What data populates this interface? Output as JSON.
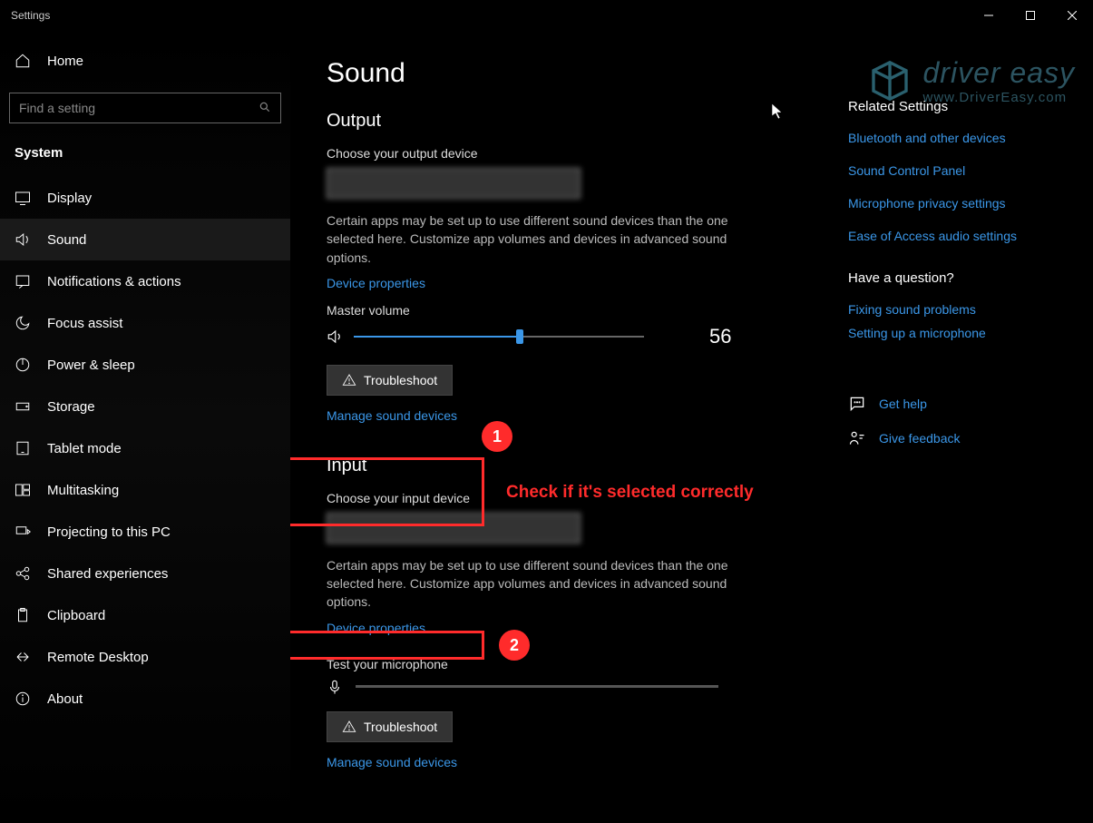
{
  "window": {
    "title": "Settings"
  },
  "sidebar": {
    "home": "Home",
    "search_placeholder": "Find a setting",
    "section": "System",
    "items": [
      {
        "label": "Display"
      },
      {
        "label": "Sound"
      },
      {
        "label": "Notifications & actions"
      },
      {
        "label": "Focus assist"
      },
      {
        "label": "Power & sleep"
      },
      {
        "label": "Storage"
      },
      {
        "label": "Tablet mode"
      },
      {
        "label": "Multitasking"
      },
      {
        "label": "Projecting to this PC"
      },
      {
        "label": "Shared experiences"
      },
      {
        "label": "Clipboard"
      },
      {
        "label": "Remote Desktop"
      },
      {
        "label": "About"
      }
    ]
  },
  "main": {
    "title": "Sound",
    "output": {
      "heading": "Output",
      "choose_label": "Choose your output device",
      "hint": "Certain apps may be set up to use different sound devices than the one selected here. Customize app volumes and devices in advanced sound options.",
      "device_props": "Device properties",
      "master_volume_label": "Master volume",
      "master_volume_value": "56",
      "troubleshoot": "Troubleshoot",
      "manage": "Manage sound devices"
    },
    "input": {
      "heading": "Input",
      "choose_label": "Choose your input device",
      "hint": "Certain apps may be set up to use different sound devices than the one selected here. Customize app volumes and devices in advanced sound options.",
      "device_props": "Device properties",
      "test_label": "Test your microphone",
      "troubleshoot": "Troubleshoot",
      "manage": "Manage sound devices"
    }
  },
  "right": {
    "related_heading": "Related Settings",
    "related": [
      "Bluetooth and other devices",
      "Sound Control Panel",
      "Microphone privacy settings",
      "Ease of Access audio settings"
    ],
    "question_heading": "Have a question?",
    "question_links": [
      "Fixing sound problems",
      "Setting up a microphone"
    ],
    "get_help": "Get help",
    "give_feedback": "Give feedback"
  },
  "annotations": {
    "circle1": "1",
    "circle2": "2",
    "text": "Check if it's selected correctly"
  },
  "watermark": {
    "line1": "driver easy",
    "line2": "www.DriverEasy.com"
  }
}
